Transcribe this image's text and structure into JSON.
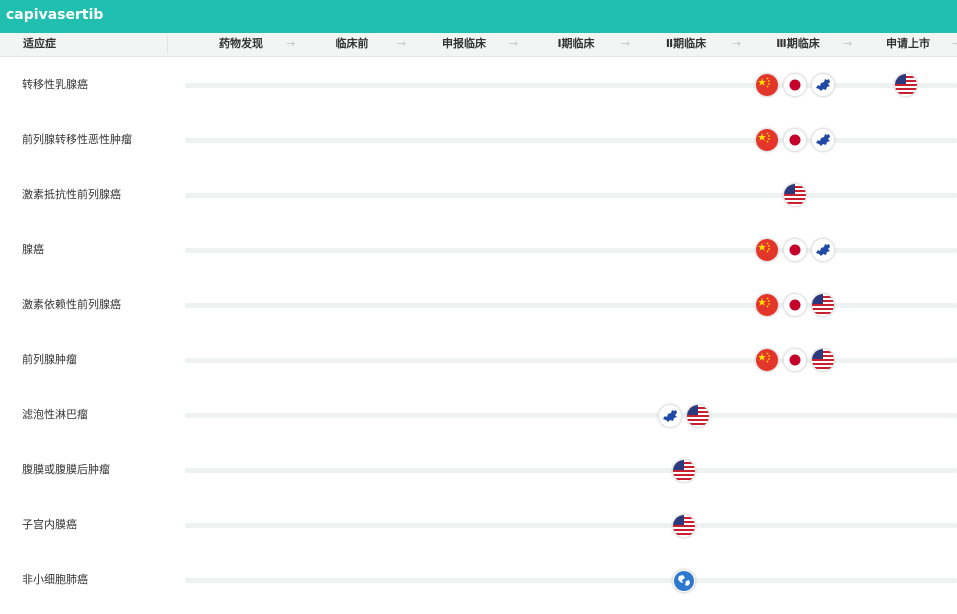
{
  "app": {
    "title": "capivasertib"
  },
  "header": {
    "indication_label": "适应症",
    "stages": [
      {
        "label": "药物发现"
      },
      {
        "label": "临床前"
      },
      {
        "label": "申报临床"
      },
      {
        "label": "Ⅰ期临床"
      },
      {
        "label": "Ⅱ期临床"
      },
      {
        "label": "Ⅲ期临床"
      },
      {
        "label": "申请上市"
      }
    ],
    "arrow_glyph": "→"
  },
  "colors": {
    "header_bar": "#20bfb0",
    "track": "#eef2f2"
  },
  "rows": [
    {
      "indication": "转移性乳腺癌",
      "markers": [
        {
          "region": "china-flag-icon",
          "stage": "Ⅲ期临床"
        },
        {
          "region": "japan-flag-icon",
          "stage": "Ⅲ期临床"
        },
        {
          "region": "eu-map-icon",
          "stage": "Ⅲ期临床"
        },
        {
          "region": "usa-flag-icon",
          "stage": "申请上市"
        }
      ]
    },
    {
      "indication": "前列腺转移性恶性肿瘤",
      "markers": [
        {
          "region": "china-flag-icon",
          "stage": "Ⅲ期临床"
        },
        {
          "region": "japan-flag-icon",
          "stage": "Ⅲ期临床"
        },
        {
          "region": "eu-map-icon",
          "stage": "Ⅲ期临床"
        }
      ]
    },
    {
      "indication": "激素抵抗性前列腺癌",
      "markers": [
        {
          "region": "usa-flag-icon",
          "stage": "Ⅲ期临床"
        }
      ]
    },
    {
      "indication": "腺癌",
      "markers": [
        {
          "region": "china-flag-icon",
          "stage": "Ⅲ期临床"
        },
        {
          "region": "japan-flag-icon",
          "stage": "Ⅲ期临床"
        },
        {
          "region": "eu-map-icon",
          "stage": "Ⅲ期临床"
        }
      ]
    },
    {
      "indication": "激素依赖性前列腺癌",
      "markers": [
        {
          "region": "china-flag-icon",
          "stage": "Ⅲ期临床"
        },
        {
          "region": "japan-flag-icon",
          "stage": "Ⅲ期临床"
        },
        {
          "region": "usa-flag-icon",
          "stage": "Ⅲ期临床"
        }
      ]
    },
    {
      "indication": "前列腺肿瘤",
      "markers": [
        {
          "region": "china-flag-icon",
          "stage": "Ⅲ期临床"
        },
        {
          "region": "japan-flag-icon",
          "stage": "Ⅲ期临床"
        },
        {
          "region": "usa-flag-icon",
          "stage": "Ⅲ期临床"
        }
      ]
    },
    {
      "indication": "滤泡性淋巴瘤",
      "markers": [
        {
          "region": "eu-map-icon",
          "stage": "Ⅱ期临床"
        },
        {
          "region": "usa-flag-icon",
          "stage": "Ⅱ期临床"
        }
      ]
    },
    {
      "indication": "腹膜或腹膜后肿瘤",
      "markers": [
        {
          "region": "usa-flag-icon",
          "stage": "Ⅱ期临床"
        }
      ]
    },
    {
      "indication": "子宫内膜癌",
      "markers": [
        {
          "region": "usa-flag-icon",
          "stage": "Ⅱ期临床"
        }
      ]
    },
    {
      "indication": "非小细胞肺癌",
      "markers": [
        {
          "region": "globe-icon",
          "stage": "Ⅱ期临床"
        }
      ]
    }
  ]
}
